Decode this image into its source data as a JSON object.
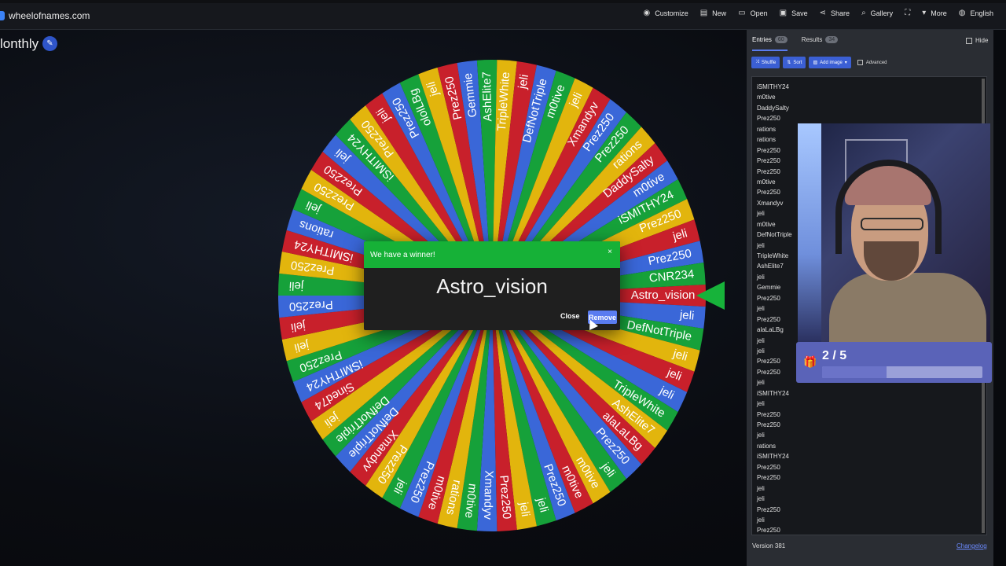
{
  "site": {
    "name": "wheelofnames.com"
  },
  "nav": [
    {
      "icon": "palette-icon",
      "glyph": "◉",
      "label": "Customize"
    },
    {
      "icon": "new-file-icon",
      "glyph": "▤",
      "label": "New"
    },
    {
      "icon": "folder-icon",
      "glyph": "▭",
      "label": "Open"
    },
    {
      "icon": "save-icon",
      "glyph": "▣",
      "label": "Save"
    },
    {
      "icon": "share-icon",
      "glyph": "⋖",
      "label": "Share"
    },
    {
      "icon": "search-icon",
      "glyph": "⌕",
      "label": "Gallery"
    },
    {
      "icon": "fullscreen-icon",
      "glyph": "⛶",
      "label": ""
    },
    {
      "icon": "chevron-down-icon",
      "glyph": "▾",
      "label": "More"
    },
    {
      "icon": "globe-icon",
      "glyph": "◍",
      "label": "English"
    }
  ],
  "wheel": {
    "title": "lonthly",
    "segment_colors": [
      "#c8202b",
      "#3a67d8",
      "#16a13a",
      "#e2b50d"
    ],
    "labels": [
      "Astro_vision",
      "jeli",
      "DefNotTriple",
      "jeli",
      "jeli",
      "jeli",
      "TripleWhite",
      "AshElite7",
      "alaLaLBg",
      "Prez250",
      "jeli",
      "m0tive",
      "m0tive",
      "Prez250",
      "jeli",
      "jeli",
      "Prez250",
      "Xmandyv",
      "m0tive",
      "rations",
      "m0tive",
      "Prez250",
      "jeli",
      "Prez250",
      "Xmandyv",
      "DefNotTriple",
      "DefNotTriple",
      "jeli",
      "Sined74",
      "iSMITHY24",
      "Prez250",
      "jeli",
      "jeli",
      "Prez250",
      "jeli",
      "Prez250",
      "iSMITHY24",
      "rations",
      "jeli",
      "Prez250",
      "Prez250",
      "jeli",
      "iSMITHY24",
      "Prez250",
      "jeli",
      "Prez250",
      "ololLBg",
      "jeli",
      "Prez250",
      "Gemmie",
      "AshElite7",
      "TripleWhite",
      "jeli",
      "DefNotTriple",
      "m0tive",
      "jeli",
      "Xmandyv",
      "Prez250",
      "Prez250",
      "rations",
      "DaddySalty",
      "m0tive",
      "iSMITHY24",
      "Prez250",
      "jeli",
      "Prez250",
      "CNR234"
    ]
  },
  "dialog": {
    "header": "We have a winner!",
    "close_x": "×",
    "winner": "Astro_vision",
    "close_label": "Close",
    "remove_label": "Remove"
  },
  "panel": {
    "tabs": [
      {
        "label": "Entries",
        "count": "60"
      },
      {
        "label": "Results",
        "count": "34"
      }
    ],
    "hide_label": "Hide",
    "tools": [
      {
        "icon": "shuffle-icon",
        "glyph": "⤨",
        "label": "Shuffle"
      },
      {
        "icon": "sort-icon",
        "glyph": "⇅",
        "label": "Sort"
      },
      {
        "icon": "image-icon",
        "glyph": "▨",
        "label": "Add image"
      }
    ],
    "advanced_label": "Advanced",
    "entries": [
      "iSMITHY24",
      "m0tive",
      "DaddySalty",
      "Prez250",
      "rations",
      "rations",
      "Prez250",
      "Prez250",
      "Prez250",
      "m0tive",
      "Prez250",
      "Xmandyv",
      "jeli",
      "m0tive",
      "DefNotTriple",
      "jeli",
      "TripleWhite",
      "AshElite7",
      "jeli",
      "Gemmie",
      "Prez250",
      "jeli",
      "Prez250",
      "alaLaLBg",
      "jeli",
      "jeli",
      "Prez250",
      "Prez250",
      "jeli",
      "iSMITHY24",
      "jeli",
      "Prez250",
      "Prez250",
      "jeli",
      "rations",
      "iSMITHY24",
      "Prez250",
      "Prez250",
      "jeli",
      "jeli",
      "Prez250",
      "jeli",
      "Prez250"
    ],
    "version": "Version 381",
    "changelog": "Changelog"
  },
  "gift": {
    "count_text": "2 / 5",
    "progress": 0.4
  }
}
